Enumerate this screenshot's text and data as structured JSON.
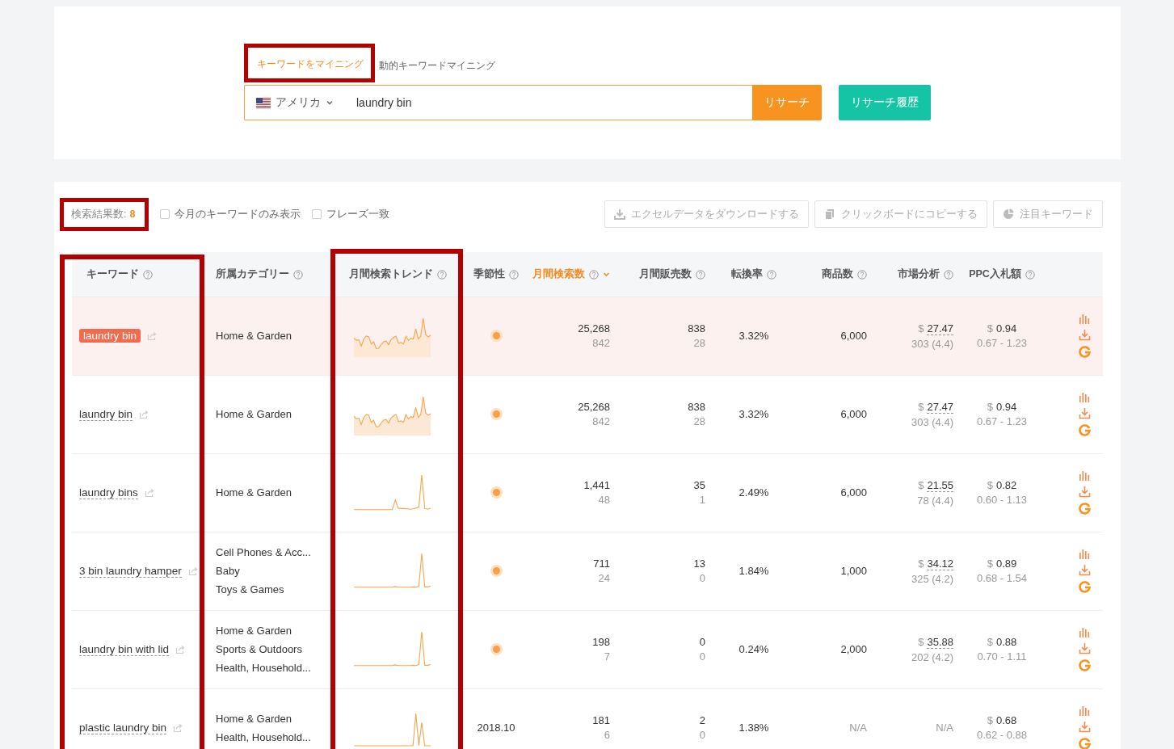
{
  "search": {
    "modes": [
      {
        "label": "キーワードをマイニング",
        "selected": true,
        "highlighted": true
      },
      {
        "label": "動的キーワードマイニング",
        "selected": false,
        "highlighted": false
      }
    ],
    "country": "アメリカ",
    "query": "laundry bin",
    "search_button": "リサーチ",
    "history_button": "リサーチ履歴"
  },
  "toolbar": {
    "results_label": "検索結果数:",
    "results_count": "8",
    "results_highlighted": true,
    "filters": [
      {
        "label": "今月のキーワードのみ表示",
        "checked": false
      },
      {
        "label": "フレーズ一致",
        "checked": false
      }
    ],
    "actions": [
      {
        "kind": "download",
        "label": "エクセルデータをダウンロードする"
      },
      {
        "kind": "copy",
        "label": "クリックボードにコピーする"
      },
      {
        "kind": "watch",
        "label": "注目キーワード"
      }
    ]
  },
  "table": {
    "columns": [
      {
        "label": "キーワード",
        "sorted": false,
        "highlighted": true
      },
      {
        "label": "所属カテゴリー",
        "sorted": false,
        "highlighted": false
      },
      {
        "label": "月間検索トレンド",
        "sorted": false,
        "highlighted": true
      },
      {
        "label": "季節性",
        "sorted": false,
        "highlighted": false
      },
      {
        "label": "月間検索数",
        "sorted": true,
        "highlighted": false
      },
      {
        "label": "月間販売数",
        "sorted": false,
        "highlighted": false
      },
      {
        "label": "転換率",
        "sorted": false,
        "highlighted": false
      },
      {
        "label": "商品数",
        "sorted": false,
        "highlighted": false
      },
      {
        "label": "市場分析",
        "sorted": false,
        "highlighted": false
      },
      {
        "label": "PPC入札額",
        "sorted": false,
        "highlighted": false
      }
    ],
    "rows": [
      {
        "keyword": "laundry bin",
        "selected": true,
        "categories": [
          "Home & Garden"
        ],
        "trend": {
          "kind": "wave"
        },
        "season": {
          "kind": "dot"
        },
        "searches": "25,268",
        "searches_sub": "842",
        "sales": "838",
        "sales_sub": "28",
        "conversion": "3.32%",
        "products": "6,000",
        "products_na": false,
        "market": {
          "kind": "price",
          "currency": "$",
          "price": "27.47",
          "reviews": "303 (4.4)"
        },
        "ppc": {
          "currency": "$",
          "bid": "0.94",
          "range": "0.67 - 1.23"
        }
      },
      {
        "keyword": "laundry bin",
        "selected": false,
        "categories": [
          "Home & Garden"
        ],
        "trend": {
          "kind": "wave"
        },
        "season": {
          "kind": "dot"
        },
        "searches": "25,268",
        "searches_sub": "842",
        "sales": "838",
        "sales_sub": "28",
        "conversion": "3.32%",
        "products": "6,000",
        "products_na": false,
        "market": {
          "kind": "price",
          "currency": "$",
          "price": "27.47",
          "reviews": "303 (4.4)"
        },
        "ppc": {
          "currency": "$",
          "bid": "0.94",
          "range": "0.67 - 1.23"
        }
      },
      {
        "keyword": "laundry bins",
        "selected": false,
        "categories": [
          "Home & Garden"
        ],
        "trend": {
          "kind": "spike-bump"
        },
        "season": {
          "kind": "dot"
        },
        "searches": "1,441",
        "searches_sub": "48",
        "sales": "35",
        "sales_sub": "1",
        "conversion": "2.49%",
        "products": "6,000",
        "products_na": false,
        "market": {
          "kind": "price",
          "currency": "$",
          "price": "21.55",
          "reviews": "78 (4.4)"
        },
        "ppc": {
          "currency": "$",
          "bid": "0.82",
          "range": "0.60 - 1.13"
        }
      },
      {
        "keyword": "3 bin laundry hamper",
        "selected": false,
        "categories": [
          "Cell Phones & Acc...",
          "Baby",
          "Toys & Games"
        ],
        "trend": {
          "kind": "spike"
        },
        "season": {
          "kind": "dot"
        },
        "searches": "711",
        "searches_sub": "24",
        "sales": "13",
        "sales_sub": "0",
        "conversion": "1.84%",
        "products": "1,000",
        "products_na": false,
        "market": {
          "kind": "price",
          "currency": "$",
          "price": "34.12",
          "reviews": "325 (4.2)"
        },
        "ppc": {
          "currency": "$",
          "bid": "0.89",
          "range": "0.68 - 1.54"
        }
      },
      {
        "keyword": "laundry bin with lid",
        "selected": false,
        "categories": [
          "Home & Garden",
          "Sports & Outdoors",
          "Health, Household..."
        ],
        "trend": {
          "kind": "spike"
        },
        "season": {
          "kind": "dot"
        },
        "searches": "198",
        "searches_sub": "7",
        "sales": "0",
        "sales_sub": "0",
        "conversion": "0.24%",
        "products": "2,000",
        "products_na": false,
        "market": {
          "kind": "price",
          "currency": "$",
          "price": "35.88",
          "reviews": "202 (4.2)"
        },
        "ppc": {
          "currency": "$",
          "bid": "0.88",
          "range": "0.70 - 1.11"
        }
      },
      {
        "keyword": "plastic laundry bin",
        "selected": false,
        "categories": [
          "Home & Garden",
          "Health, Household..."
        ],
        "trend": {
          "kind": "double-spike"
        },
        "season": {
          "kind": "text",
          "text": "2018.10"
        },
        "searches": "181",
        "searches_sub": "6",
        "sales": "2",
        "sales_sub": "0",
        "conversion": "1.38%",
        "products": "N/A",
        "products_na": true,
        "market": {
          "kind": "na",
          "text": "N/A"
        },
        "ppc": {
          "currency": "$",
          "bid": "0.68",
          "range": "0.62 - 0.88"
        }
      }
    ]
  }
}
